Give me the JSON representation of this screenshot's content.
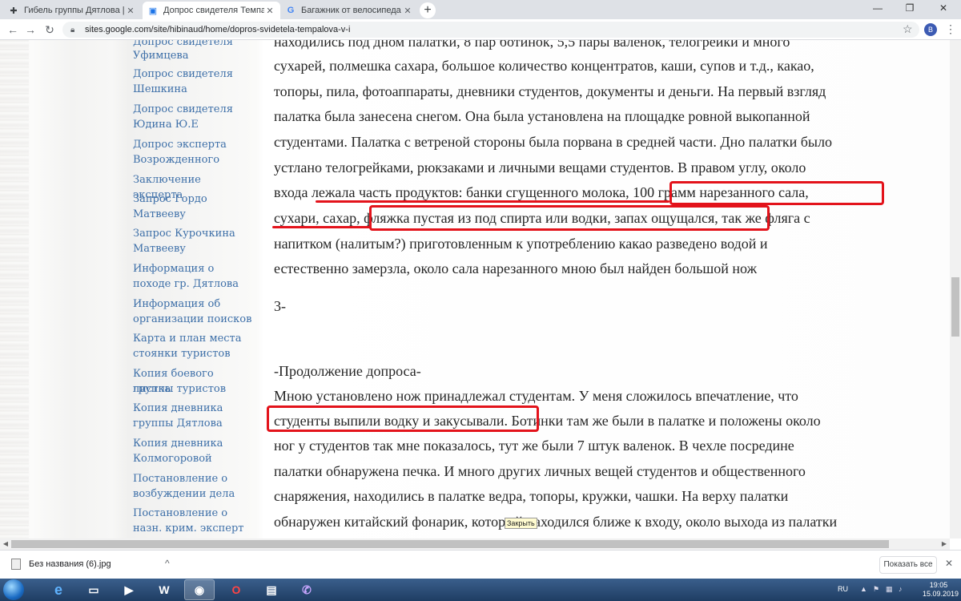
{
  "tabs": [
    {
      "title": "Гибель группы Дятлова | Стран",
      "favicon": "cross-icon"
    },
    {
      "title": "Допрос свидетеля Темпалова В",
      "favicon": "sites-icon"
    },
    {
      "title": "Багажник от велосипеда ссср -",
      "favicon": "google-icon"
    }
  ],
  "address": "sites.google.com/site/hibinaud/home/dopros-svidetela-tempalova-v-i",
  "profile_initial": "B",
  "sidebar": [
    "Допрос свидетеля",
    "Уфимцева",
    "Допрос свидетеля",
    "Шешкина",
    "Допрос свидетеля",
    "Юдина Ю.Е",
    "Допрос эксперта",
    "Возрожденного",
    "Заключение эксперта",
    "Запрос Гордо",
    "Матвееву",
    "Запрос Курочкина",
    "Матвееву",
    "Информация о",
    "походе гр. Дятлова",
    "Информация об",
    "организации поисков",
    "Карта и план места",
    "стоянки туристов",
    "Копия боевого листка",
    "группы туристов",
    "Копия дневника",
    "группы Дятлова",
    "Копия дневника",
    "Колмогоровой",
    "Постановление о",
    "возбуждении дела",
    "Постановление о",
    "назн. крим. эксперт"
  ],
  "content_lines": [
    "находились под дном палатки, 8 пар ботинок, 5,5 пары валенок, телогрейки и много",
    "сухарей, полмешка сахара, большое количество концентратов, каши, супов и т.д., какао,",
    "топоры, пила, фотоаппараты, дневники студентов, документы и деньги. На первый взгляд",
    "палатка была занесена снегом. Она была установлена на площадке ровной выкопанной",
    "студентами. Палатка с ветреной стороны была порвана в средней части. Дно палатки было",
    "устлано телогрейками, рюкзаками и личными вещами студентов. В правом углу, около",
    "входа лежала часть продуктов: банки сгущенного молока, 100 грамм нарезанного сала,",
    "сухари, сахар, фляжка пустая из под спирта или водки, запах ощущался, так же фляга с",
    "напитком (налитым?) приготовленным к употреблению какао разведено водой и",
    "естественно замерзла, около сала нарезанного мною был найден большой нож",
    "3-",
    "-Продолжение допроса-",
    "Мною установлено нож принадлежал студентам. У меня сложилось впечатление, что",
    "студенты выпили водку и закусывали. Ботинки там же были в палатке и положены около",
    "ног у студентов так мне показалось, тут же были 7 штук валенок. В чехле посредине",
    "палатки обнаружена печка. И много других личных вещей студентов и общественного",
    "снаряжения, находились в палатке ведра, топоры, кружки, чашки. На верху палатки",
    "обнаружен китайский фонарик, который находился ближе к входу, около выхода из палатки"
  ],
  "tooltip": "Закрыть",
  "download": {
    "filename": "Без названия (6).jpg",
    "show_all": "Показать все"
  },
  "tray": {
    "lang": "RU",
    "time": "19:05",
    "date": "15.09.2019"
  },
  "colors": {
    "annotation": "#e3131b",
    "link": "#3d6fa8",
    "text": "#262626"
  }
}
